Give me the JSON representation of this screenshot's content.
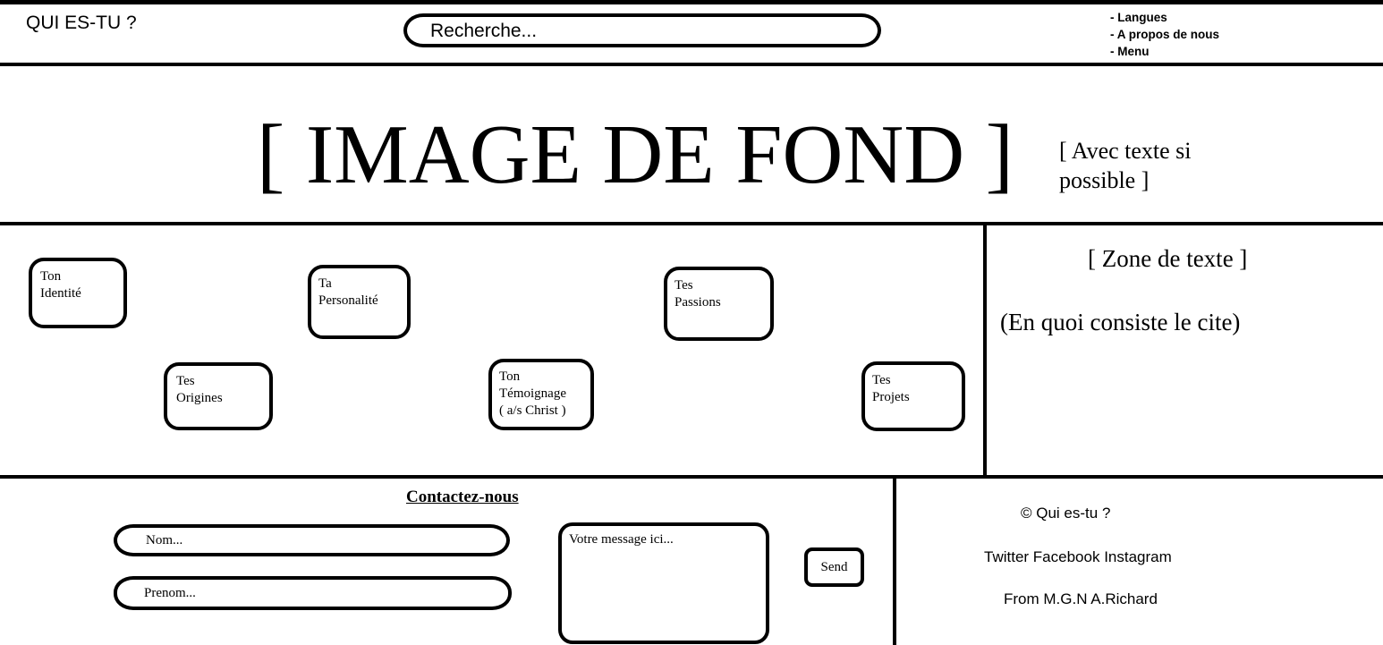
{
  "header": {
    "brand": "QUI ES-TU ?",
    "search_placeholder": "Recherche...",
    "menu": [
      "- Langues",
      "- A propos de nous",
      "- Menu"
    ]
  },
  "hero": {
    "title": "[ IMAGE DE FOND ]",
    "subtitle": "[ Avec texte si possible ]"
  },
  "categories": [
    {
      "label": "Ton\n Identité"
    },
    {
      "label": "Ta\nPersonalité"
    },
    {
      "label": "Tes\nPassions"
    },
    {
      "label": "Tes\nOrigines"
    },
    {
      "label": "Ton\nTémoignage\n( a/s Christ )"
    },
    {
      "label": "Tes\nProjets"
    }
  ],
  "text_zone": {
    "title": "[ Zone de texte ]",
    "body": "(En quoi consiste le cite)"
  },
  "contact": {
    "title": "Contactez-nous",
    "name_placeholder": "Nom...",
    "firstname_placeholder": "Prenom...",
    "message_placeholder": "Votre message ici...",
    "send_label": "Send"
  },
  "footer": {
    "copyright": "© Qui es-tu ?",
    "socials": [
      "Twitter",
      "Facebook",
      "Instagram"
    ],
    "credit": "From M.G.N A.Richard"
  }
}
